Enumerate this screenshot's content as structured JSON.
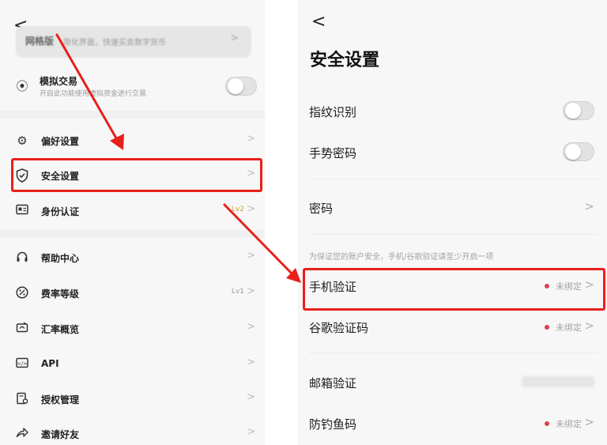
{
  "left": {
    "back_glyph": "<",
    "promo": {
      "title": "网格版",
      "subtitle": "简化界面，快速买卖数字货币",
      "arrow": ">"
    },
    "demo_trading": {
      "title": "模拟交易",
      "subtitle": "开启此功能使用虚拟资金进行交易",
      "toggle_on": false
    },
    "menu": [
      {
        "label": "偏好设置",
        "icon": "gear-icon",
        "badge": ""
      },
      {
        "label": "安全设置",
        "icon": "shield-icon",
        "badge": ""
      },
      {
        "label": "身份认证",
        "icon": "id-card-icon",
        "badge": "Lv2"
      },
      {
        "label": "帮助中心",
        "icon": "headset-icon",
        "badge": ""
      },
      {
        "label": "费率等级",
        "icon": "percent-icon",
        "badge": "Lv1"
      },
      {
        "label": "汇率概览",
        "icon": "exchange-icon",
        "badge": ""
      },
      {
        "label": "API",
        "icon": "api-icon",
        "badge": ""
      },
      {
        "label": "授权管理",
        "icon": "authorization-icon",
        "badge": ""
      },
      {
        "label": "邀请好友",
        "icon": "share-icon",
        "badge": ""
      }
    ]
  },
  "right": {
    "back_glyph": "<",
    "title": "安全设置",
    "fingerprint": {
      "label": "指纹识别",
      "toggle_on": false
    },
    "gesture": {
      "label": "手势密码",
      "toggle_on": false
    },
    "password": {
      "label": "密码"
    },
    "hint": "为保证您的账户安全，手机/谷歌验证请至少开启一项",
    "phone": {
      "label": "手机验证",
      "status": "未绑定"
    },
    "google": {
      "label": "谷歌验证码",
      "status": "未绑定"
    },
    "email": {
      "label": "邮箱验证"
    },
    "anti_phishing": {
      "label": "防钓鱼码",
      "status": "未绑定"
    }
  },
  "chevron": ">",
  "colors": {
    "highlight": "#e8201a",
    "status_dot": "#d9434e",
    "badge_gold": "#c9a14a"
  }
}
